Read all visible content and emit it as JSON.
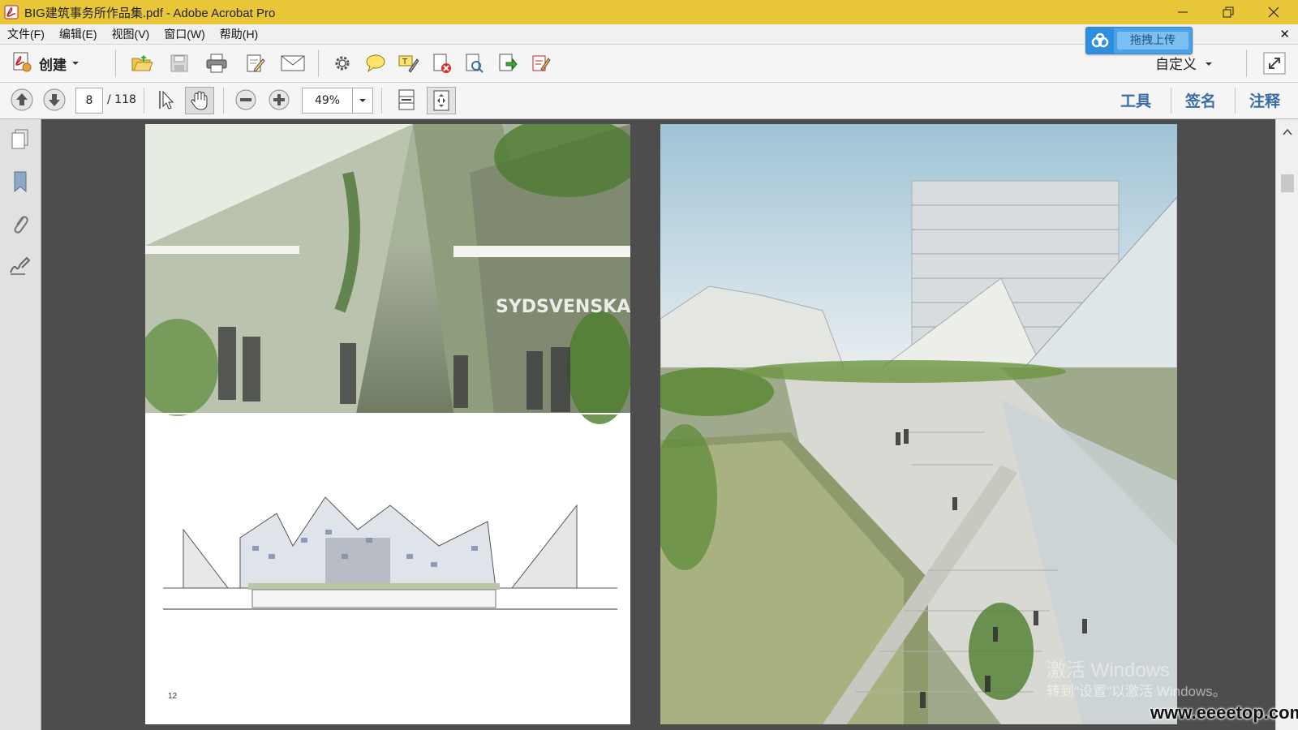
{
  "window": {
    "title": "BIG建筑事务所作品集.pdf - Adobe Acrobat Pro"
  },
  "menu": {
    "items": [
      "文件(F)",
      "编辑(E)",
      "视图(V)",
      "窗口(W)",
      "帮助(H)"
    ]
  },
  "upload": {
    "label": "拖拽上传"
  },
  "toolbar": {
    "create_label": "创建",
    "customize_label": "自定义"
  },
  "nav": {
    "current_page": "8",
    "total_pages": "/ 118",
    "zoom": "49%"
  },
  "panels": {
    "tools": "工具",
    "sign": "签名",
    "comment": "注释"
  },
  "document": {
    "left_page_number": "12"
  },
  "watermarks": {
    "activate_title": "激活 Windows",
    "activate_sub": "转到\"设置\"以激活 Windows。",
    "site": "www.eeeetop.com"
  },
  "colors": {
    "titlebar": "#e8c638",
    "accent_blue": "#3a6da8",
    "acrobat_red": "#c0201d"
  }
}
